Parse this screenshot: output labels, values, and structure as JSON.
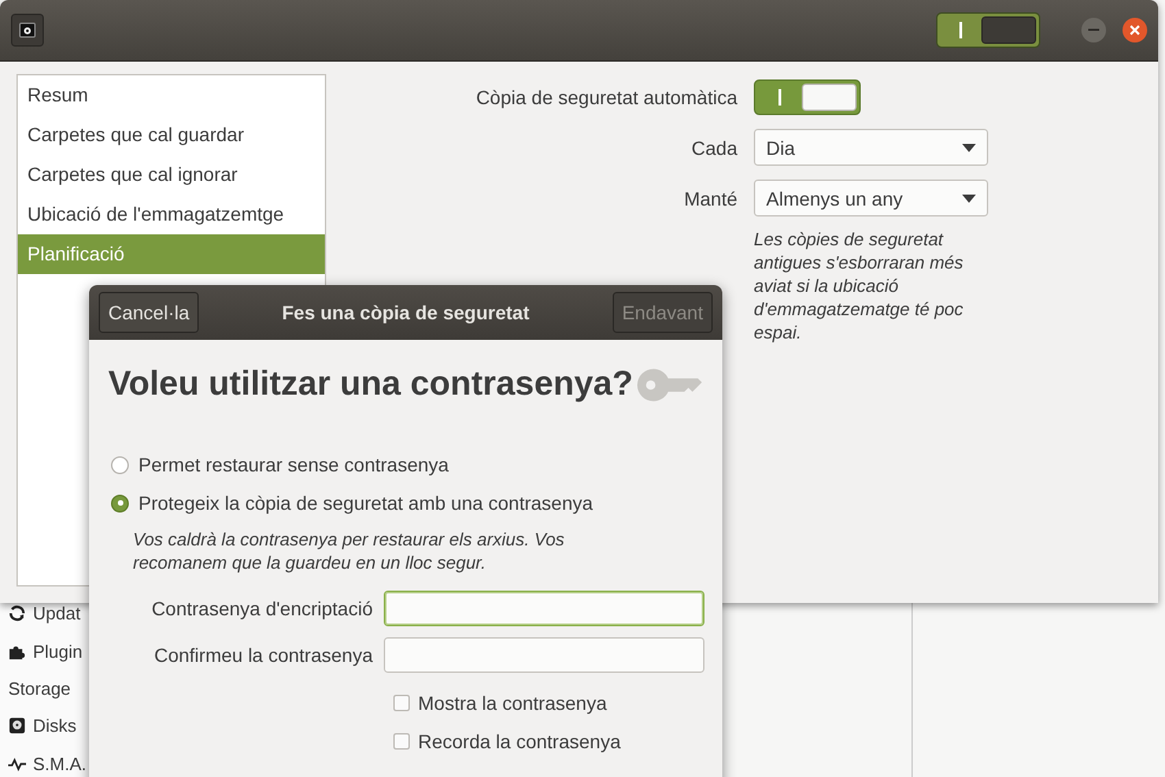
{
  "main_window": {
    "header_switch": {
      "on": true
    },
    "sidebar": {
      "items": [
        {
          "label": "Resum",
          "selected": false
        },
        {
          "label": "Carpetes que cal guardar",
          "selected": false
        },
        {
          "label": "Carpetes que cal ignorar",
          "selected": false
        },
        {
          "label": "Ubicació de l'emmagatzemtge",
          "selected": false
        },
        {
          "label": "Planificació",
          "selected": true
        }
      ]
    },
    "settings": {
      "auto_backup": {
        "label": "Còpia de seguretat automàtica",
        "on": true
      },
      "frequency": {
        "label": "Cada",
        "value": "Dia"
      },
      "keep": {
        "label": "Manté",
        "value": "Almenys un any"
      },
      "note": "Les còpies de seguretat antigues s'esborraran més aviat si la ubicació d'emmagatzematge té poc espai."
    }
  },
  "background_window": {
    "items": [
      {
        "label": "Updat",
        "kind": "refresh"
      },
      {
        "label": "Plugin",
        "kind": "puzzle"
      },
      {
        "label": "Storage",
        "kind": "heading"
      },
      {
        "label": "Disks",
        "kind": "disk"
      },
      {
        "label": "S.M.A.",
        "kind": "pulse"
      }
    ]
  },
  "dialog": {
    "title": "Fes una còpia de seguretat",
    "cancel_button": {
      "label": "Cancel·la",
      "disabled": false
    },
    "forward_button": {
      "label": "Endavant",
      "disabled": true
    },
    "heading": "Voleu utilitzar una contrasenya?",
    "options": [
      {
        "label": "Permet restaurar sense contrasenya",
        "selected": false
      },
      {
        "label": "Protegeix la còpia de seguretat amb una contrasenya",
        "selected": true
      }
    ],
    "hint": "Vos caldrà la contrasenya per restaurar els arxius. Vos recomanem que la guardeu en un lloc segur.",
    "fields": [
      {
        "label": "Contrasenya d'encriptació",
        "focused": true
      },
      {
        "label": "Confirmeu la contrasenya",
        "focused": false
      }
    ],
    "checkboxes": [
      {
        "label": "Mostra la contrasenya",
        "checked": false
      },
      {
        "label": "Recorda la contrasenya",
        "checked": false
      }
    ]
  }
}
